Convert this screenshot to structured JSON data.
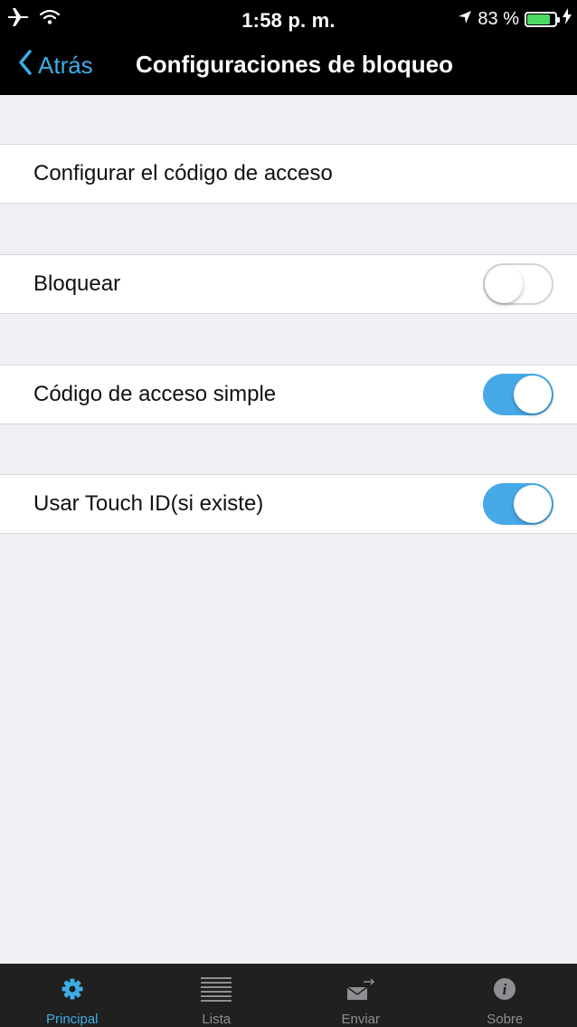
{
  "status_bar": {
    "time": "1:58 p. m.",
    "battery": "83 %",
    "battery_level": 0.83,
    "icons": [
      "airplane-icon",
      "wifi-icon",
      "location-icon",
      "battery-icon",
      "charging-icon"
    ]
  },
  "nav": {
    "back_label": "Atrás",
    "title": "Configuraciones de bloqueo"
  },
  "settings": {
    "passcode_row": "Configurar el código de acceso",
    "lock_row": {
      "label": "Bloquear",
      "enabled": false
    },
    "simple_code_row": {
      "label": "Código de acceso simple",
      "enabled": true
    },
    "touch_id_row": {
      "label": "Usar Touch ID(si existe)",
      "enabled": true
    }
  },
  "tabbar": {
    "tabs": [
      {
        "label": "Principal",
        "icon": "gear-icon",
        "active": true
      },
      {
        "label": "Lista",
        "icon": "list-icon",
        "active": false
      },
      {
        "label": "Enviar",
        "icon": "envelope-send-icon",
        "active": false
      },
      {
        "label": "Sobre",
        "icon": "info-icon",
        "active": false
      }
    ]
  },
  "colors": {
    "accent": "#3dade4",
    "toggle_on": "#47a9e8",
    "bar_background": "#000000",
    "tabbar_background": "#202020",
    "page_background": "#efeff4"
  }
}
